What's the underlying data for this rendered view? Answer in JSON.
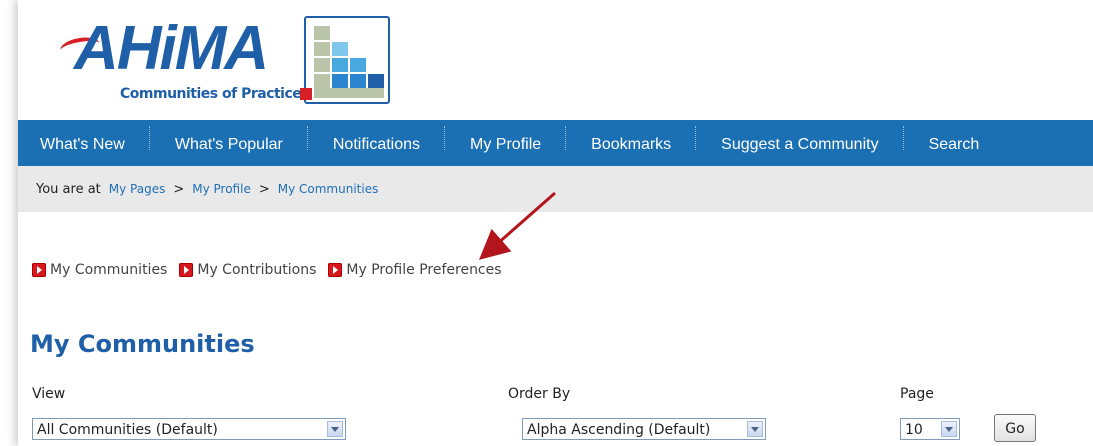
{
  "logo": {
    "wordmark": "AHiMA",
    "tagline": "Communities of Practice"
  },
  "nav": {
    "items": [
      {
        "label": "What's New"
      },
      {
        "label": "What's Popular"
      },
      {
        "label": "Notifications"
      },
      {
        "label": "My Profile"
      },
      {
        "label": "Bookmarks"
      },
      {
        "label": "Suggest a Community"
      },
      {
        "label": "Search"
      }
    ]
  },
  "breadcrumb": {
    "lead": "You are at",
    "items": [
      "My Pages",
      "My Profile",
      "My Communities"
    ],
    "separator": ">"
  },
  "sublinks": [
    {
      "label": "My Communities",
      "icon": "red-play-icon"
    },
    {
      "label": "My Contributions",
      "icon": "red-play-icon"
    },
    {
      "label": "My Profile Preferences",
      "icon": "red-play-icon"
    }
  ],
  "page_title": "My Communities",
  "filters": {
    "view": {
      "label": "View",
      "selected": "All Communities (Default)"
    },
    "order": {
      "label": "Order By",
      "selected": "Alpha Ascending (Default)"
    },
    "page": {
      "label": "Page",
      "selected": "10"
    },
    "go_label": "Go"
  },
  "colors": {
    "nav_bg": "#1b6fb3",
    "brand_blue": "#1f5fa8",
    "accent_red": "#d61f26",
    "breadcrumb_bg": "#e9e9e9",
    "link": "#1f6fb5"
  }
}
